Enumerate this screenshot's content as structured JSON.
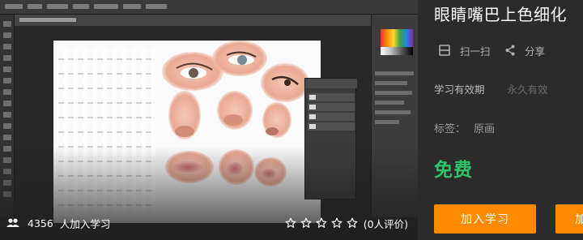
{
  "course": {
    "title": "眼睛嘴巴上色细化",
    "actions": {
      "scan_label": "扫一扫",
      "share_label": "分享"
    },
    "validity": {
      "label": "学习有效期",
      "value": "永久有效"
    },
    "tags": {
      "label": "标签：",
      "value": "原画"
    },
    "price": "免费",
    "buttons": {
      "join_label": "加入学习",
      "second_label": "加"
    }
  },
  "preview": {
    "learner_count": "4356",
    "learner_text": "人加入学习",
    "rating_stars": 0,
    "rating_max": 5,
    "rating_count_text": "(0人评价)"
  },
  "colors": {
    "accent": "#ff8a00",
    "price": "#2fc26a",
    "panel_bg": "#2b2b2b"
  },
  "icons": [
    "scan-icon",
    "share-icon",
    "users-icon",
    "star-outline-icon"
  ]
}
